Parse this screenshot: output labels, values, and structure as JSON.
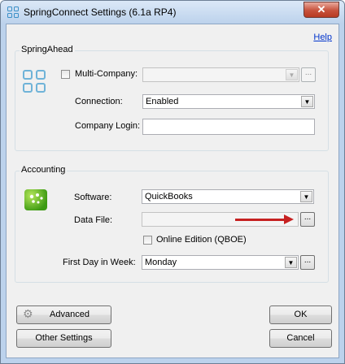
{
  "window": {
    "title": "SpringConnect Settings (6.1a RP4)",
    "close_label": "✕",
    "help_label": "Help"
  },
  "springahead": {
    "group_title": "SpringAhead",
    "multi_company_label": "Multi-Company:",
    "multi_company_value": "",
    "connection_label": "Connection:",
    "connection_value": "Enabled",
    "company_login_label": "Company Login:",
    "company_login_value": ""
  },
  "accounting": {
    "group_title": "Accounting",
    "software_label": "Software:",
    "software_value": "QuickBooks",
    "data_file_label": "Data File:",
    "data_file_value": "",
    "online_edition_label": "Online Edition (QBOE)",
    "first_day_label": "First Day in Week:",
    "first_day_value": "Monday"
  },
  "buttons": {
    "browse": "...",
    "advanced": "Advanced",
    "other_settings": "Other Settings",
    "ok": "OK",
    "cancel": "Cancel"
  },
  "icons": {
    "combo_arrow": "▼",
    "gear": "⚙"
  },
  "colors": {
    "arrow_annotation": "#c62121"
  }
}
